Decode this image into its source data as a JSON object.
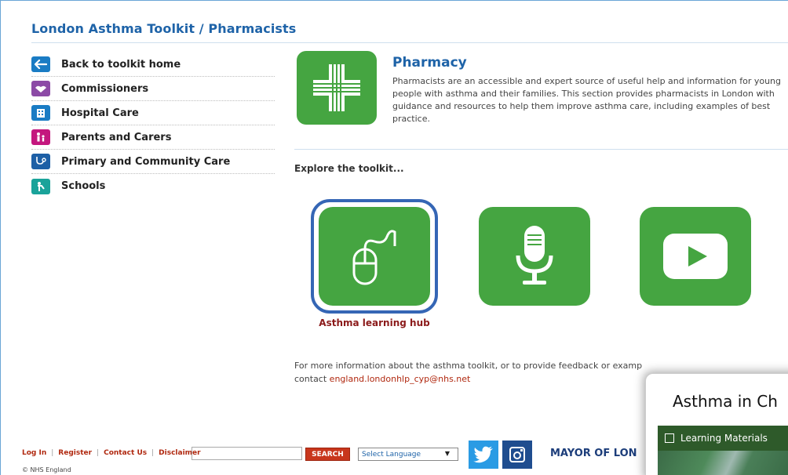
{
  "header": {
    "title": "London Asthma Toolkit / Pharmacists"
  },
  "sidebar": {
    "items": [
      {
        "label": "Back to toolkit home",
        "icon": "arrow-left-icon",
        "color": "#1a7cc4"
      },
      {
        "label": "Commissioners",
        "icon": "handshake-icon",
        "color": "#8c4aa6"
      },
      {
        "label": "Hospital Care",
        "icon": "hospital-icon",
        "color": "#1a7cc4"
      },
      {
        "label": "Parents and Carers",
        "icon": "family-icon",
        "color": "#c4177e"
      },
      {
        "label": "Primary and Community Care",
        "icon": "stethoscope-icon",
        "color": "#1d5fa6"
      },
      {
        "label": "Schools",
        "icon": "student-icon",
        "color": "#1aa39a"
      }
    ]
  },
  "pharmacy": {
    "title": "Pharmacy",
    "description": "Pharmacists are an accessible and expert source of useful help and information for young people with asthma and their families. This section provides pharmacists in London with guidance and resources to help them improve asthma care, including examples of best practice.",
    "logo_icon": "pharmacy-cross-icon"
  },
  "explore": {
    "heading": "Explore the toolkit...",
    "tiles": [
      {
        "icon": "mouse-icon",
        "caption": "Asthma learning hub"
      },
      {
        "icon": "microphone-icon",
        "caption": ""
      },
      {
        "icon": "video-play-icon",
        "caption": ""
      }
    ]
  },
  "contact": {
    "text": "For more information about the asthma toolkit, or to provide feedback or examp",
    "text_tail": "contact",
    "email": "england.londonhlp_cyp@nhs.net"
  },
  "footer": {
    "links": [
      "Log In",
      "Register",
      "Contact Us",
      "Disclaimer"
    ],
    "search_button": "SEARCH",
    "search_value": "",
    "language_select": "Select Language",
    "copyright": "© NHS England",
    "mayor_text": "MAYOR OF LON"
  },
  "popup": {
    "title": "Asthma in Ch",
    "bar_label": "Learning Materials"
  },
  "colors": {
    "brand_blue": "#1e63a8",
    "tile_green": "#45a541",
    "link_red": "#b0280f",
    "focus_blue": "#3566b5"
  }
}
